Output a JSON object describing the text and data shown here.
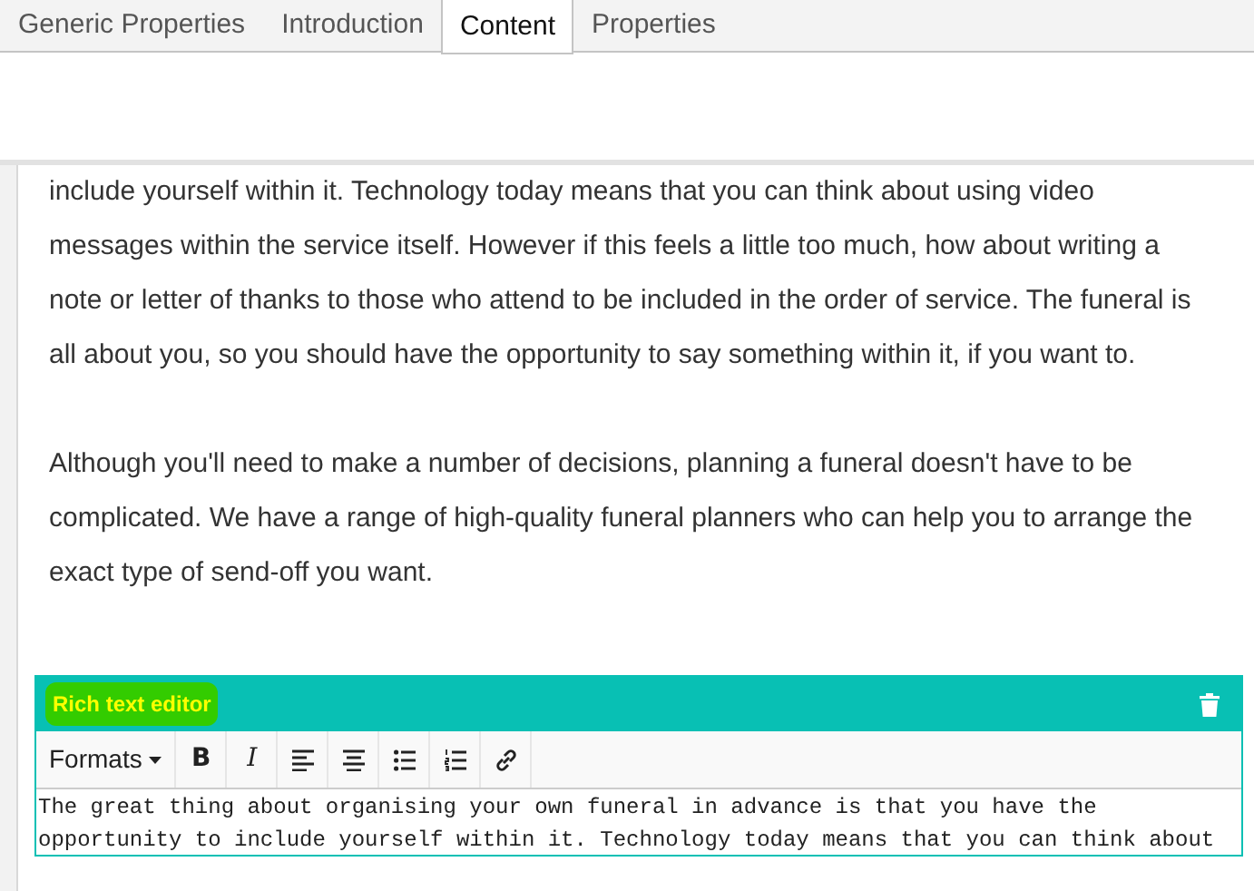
{
  "tabs": [
    {
      "label": "Generic Properties",
      "selected": false
    },
    {
      "label": "Introduction",
      "selected": false
    },
    {
      "label": "Content",
      "selected": true
    },
    {
      "label": "Properties",
      "selected": false
    }
  ],
  "content": {
    "paragraphs": [
      "include yourself within it. Technology today means that you can think about using video messages within the service itself. However if this feels a little too much, how about writing a note or letter of thanks to those who attend to be included in the order of service. The funeral is all about you, so you should have the opportunity to say something within it, if you want to.",
      "Although you'll need to make a number of decisions, planning a funeral doesn't have to be complicated. We have a range of high-quality funeral planners who can help you to arrange the exact type of send-off you want."
    ]
  },
  "editor": {
    "title": "Rich text editor",
    "toolbar": [
      {
        "kind": "dropdown",
        "label": "Formats"
      },
      {
        "kind": "bold",
        "label": "B"
      },
      {
        "kind": "italic",
        "label": "I"
      },
      {
        "kind": "alignleft"
      },
      {
        "kind": "aligncenter"
      },
      {
        "kind": "bullets"
      },
      {
        "kind": "numbering"
      },
      {
        "kind": "link"
      }
    ],
    "text": "The great thing about organising your own funeral in advance is that you have the opportunity to include yourself within it. Technology today means that you can think about"
  }
}
